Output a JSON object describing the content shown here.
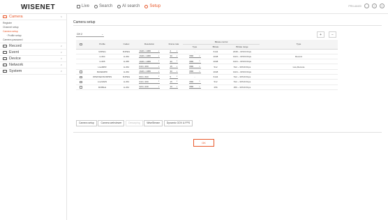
{
  "header": {
    "logo": "WISENET",
    "nav": [
      {
        "label": "Live"
      },
      {
        "label": "Search"
      },
      {
        "label": "AI search"
      },
      {
        "label": "Setup"
      }
    ],
    "model": "PRN-A6400",
    "help_glyph": "?",
    "user_glyph": "≡"
  },
  "sidebar": {
    "groups": [
      {
        "label": "Camera",
        "chevron": "∧",
        "items": [
          "Register",
          "Channel setup",
          "Camera setup",
          "Profile setup",
          "Camera password"
        ]
      },
      {
        "label": "Record",
        "chevron": "∨"
      },
      {
        "label": "Event",
        "chevron": "∨"
      },
      {
        "label": "Device",
        "chevron": "∨"
      },
      {
        "label": "Network",
        "chevron": "∨"
      },
      {
        "label": "System",
        "chevron": "∨"
      }
    ]
  },
  "main": {
    "title": "Camera setup",
    "channel": "CH 2",
    "channel_arrow": "⌄",
    "add_glyph": "+",
    "delete_glyph": "−",
    "table": {
      "group_header": "Bitrate control",
      "headers": {
        "profile": "Profile",
        "codec": "Codec",
        "resolution": "Resolution",
        "frame_rate": "Frame rate",
        "type": "Type",
        "bitrate": "Bitrate",
        "bitrate_range": "Bitrate range",
        "type2": "Type"
      },
      "rows": [
        {
          "profile": "MJPEG",
          "codec": "MJPEG",
          "resolution": "1920 x 1080",
          "frame": "2",
          "ctype": "-",
          "bitrate": "6144",
          "range": "2048 ~ 30720 Kbps",
          "type": "",
          "check": false
        },
        {
          "profile": "H.264",
          "codec": "H.264",
          "resolution": "1920 x 1080",
          "frame": "30",
          "ctype": "VBR",
          "bitrate": "2048",
          "range": "1024 ~ 30720 Kbps",
          "type": "Record",
          "check": false
        },
        {
          "profile": "H.265",
          "codec": "H.265",
          "resolution": "1920 x 1080",
          "frame": "30",
          "ctype": "VBR",
          "bitrate": "2048",
          "range": "1024 ~ 30720 Kbps",
          "type": "",
          "check": false
        },
        {
          "profile": "LiveMPR",
          "codec": "H.264",
          "resolution": "640 x 360",
          "frame": "15",
          "ctype": "VBR",
          "bitrate": "512",
          "range": "512 ~ 30720 Kbps",
          "type": "Live,Remote",
          "check": false
        },
        {
          "profile": "BASEMPR",
          "codec": "H.264",
          "resolution": "1920 x 1080",
          "frame": "30",
          "ctype": "VBR",
          "bitrate": "2048",
          "range": "1024 ~ 30720 Kbps",
          "type": "",
          "check": true
        },
        {
          "profile": "OPENSENSORPRS",
          "codec": "MJPEG",
          "resolution": "800 x 600",
          "frame": "5",
          "ctype": "-",
          "bitrate": "6144",
          "range": "512 ~ 30720 Kbps",
          "type": "",
          "check": true
        },
        {
          "profile": "LiveVIEW",
          "codec": "H.264",
          "resolution": "640 x 360",
          "frame": "15",
          "ctype": "VBR",
          "bitrate": "512",
          "range": "512 ~ 30720 Kbps",
          "type": "",
          "check": true
        },
        {
          "profile": "MOBILE",
          "codec": "H.264",
          "resolution": "320 x 240",
          "frame": "10",
          "ctype": "VBR",
          "bitrate": "256",
          "range": "256 ~ 30720 Kbps",
          "type": "",
          "check": true
        }
      ]
    },
    "buttons": [
      {
        "label": "Camera setup",
        "disabled": false
      },
      {
        "label": "Camera webviewer",
        "disabled": false
      },
      {
        "label": "Dewarping",
        "disabled": true
      },
      {
        "label": "WiseStream",
        "disabled": false
      },
      {
        "label": "Dynamic GOV & FPS",
        "disabled": false
      }
    ],
    "ok_label": "OK"
  }
}
